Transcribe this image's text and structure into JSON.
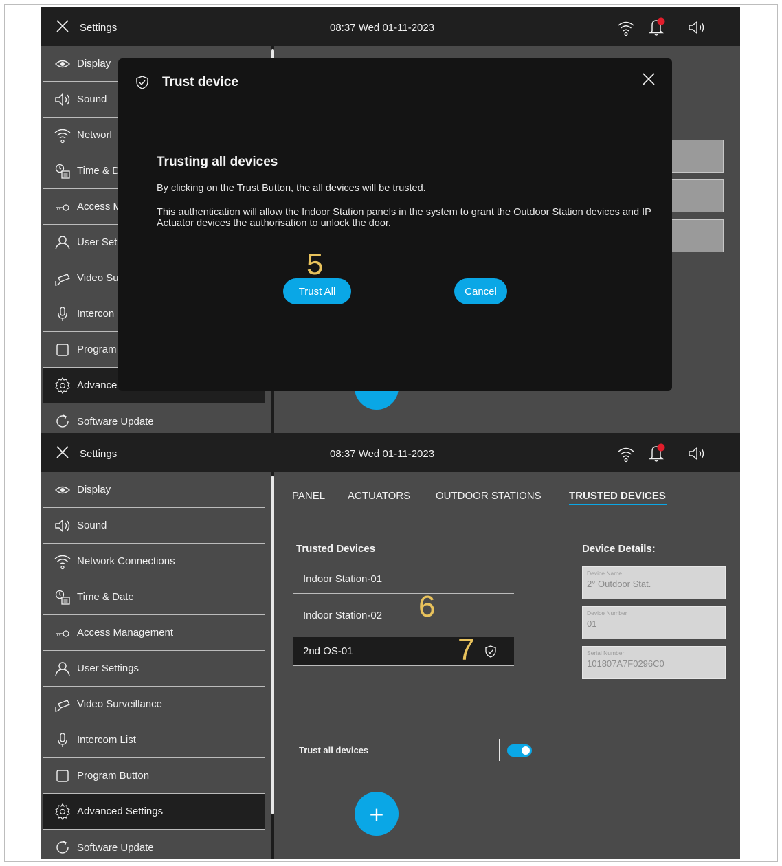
{
  "status_bar": {
    "title": "Settings",
    "clock": "08:37  Wed 01-11-2023"
  },
  "sidebar": {
    "items": [
      {
        "label": "Display",
        "icon": "eye-icon"
      },
      {
        "label": "Sound",
        "icon": "speaker-icon"
      },
      {
        "label": "Network Connections",
        "icon": "wifi-icon"
      },
      {
        "label": "Time & Date",
        "icon": "clock-calendar-icon"
      },
      {
        "label": "Access Management",
        "icon": "key-icon"
      },
      {
        "label": "User Settings",
        "icon": "user-icon"
      },
      {
        "label": "Video Surveillance",
        "icon": "camera-icon"
      },
      {
        "label": "Intercom List",
        "icon": "microphone-icon"
      },
      {
        "label": "Program Button",
        "icon": "square-button-icon"
      },
      {
        "label": "Advanced Settings",
        "icon": "gear-icon"
      },
      {
        "label": "Software Update",
        "icon": "refresh-icon"
      }
    ],
    "top_visible_labels": [
      "Display",
      "Sound",
      "Networl",
      "Time & D",
      "Access M",
      "User Set",
      "Video Su",
      "Intercon",
      "Program",
      "Advanced Settings",
      "Software Update"
    ]
  },
  "dialog": {
    "title": "Trust device",
    "heading": "Trusting all devices",
    "text1": "By clicking on the Trust Button, the all devices will be trusted.",
    "text2": "This authentication will allow the Indoor Station panels in the system to grant the Outdoor Station devices and IP Actuator devices the authorisation to unlock the door.",
    "trust_all_label": "Trust All",
    "cancel_label": "Cancel"
  },
  "tabs": [
    {
      "label": "PANEL",
      "active": false
    },
    {
      "label": "ACTUATORS",
      "active": false
    },
    {
      "label": "OUTDOOR STATIONS",
      "active": false
    },
    {
      "label": "TRUSTED DEVICES",
      "active": true
    }
  ],
  "trusted_devices": {
    "heading": "Trusted Devices",
    "items": [
      {
        "label": "Indoor Station-01",
        "selected": false
      },
      {
        "label": "Indoor Station-02",
        "selected": false
      },
      {
        "label": "2nd OS-01",
        "selected": true
      }
    ]
  },
  "device_details": {
    "heading": "Device Details:",
    "fields": [
      {
        "label": "Device Name",
        "value": "2° Outdoor Stat."
      },
      {
        "label": "Device Number",
        "value": "01"
      },
      {
        "label": "Serial Number",
        "value": "101807A7F0296C0"
      }
    ]
  },
  "trust_all": {
    "label": "Trust all devices",
    "enabled": true
  },
  "fab": {
    "symbol": "+"
  },
  "callouts": {
    "c5": "5",
    "c6": "6",
    "c7": "7"
  },
  "colors": {
    "accent": "#0aa7e6",
    "status_bar": "#1f1f1f",
    "panel": "#4a4a4a",
    "dialog": "#141414",
    "callout": "#e8c25c",
    "notification": "#e11d2b"
  }
}
